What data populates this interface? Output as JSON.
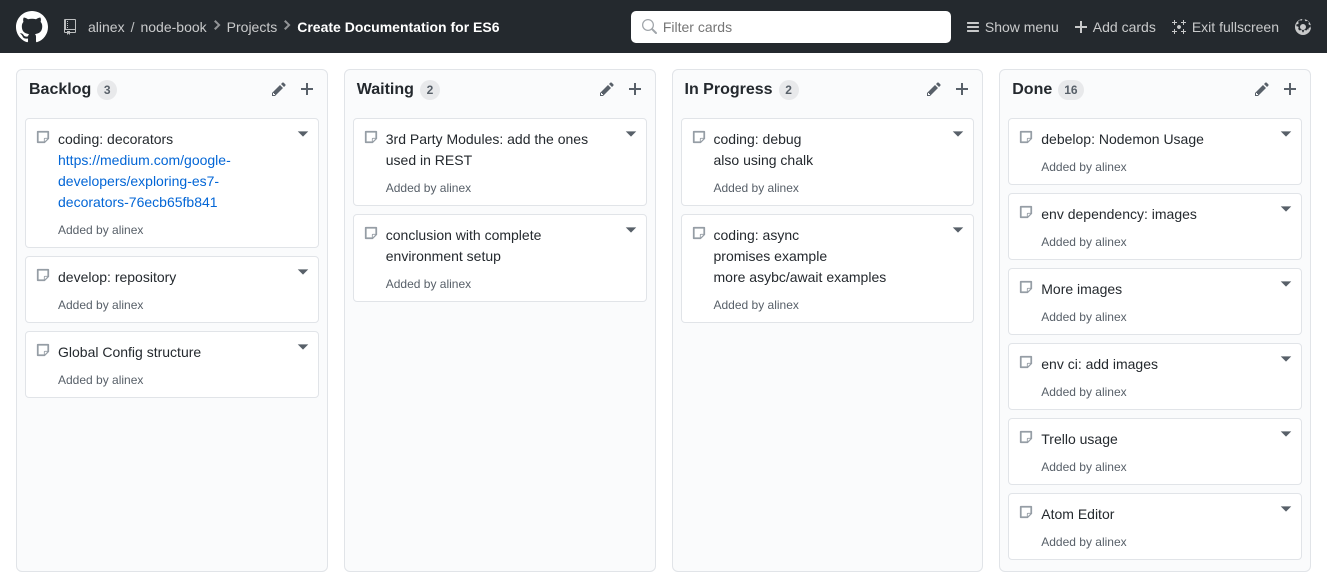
{
  "header": {
    "owner": "alinex",
    "repo": "node-book",
    "projects_label": "Projects",
    "project_name": "Create Documentation for ES6",
    "search_placeholder": "Filter cards",
    "show_menu": "Show menu",
    "add_cards": "Add cards",
    "exit_fullscreen": "Exit fullscreen"
  },
  "added_by_prefix": "Added by ",
  "columns": [
    {
      "title": "Backlog",
      "count": "3",
      "cards": [
        {
          "text": "coding: decorators",
          "link": "https://medium.com/google-developers/exploring-es7-decorators-76ecb65fb841",
          "added_by": "alinex"
        },
        {
          "text": "develop: repository",
          "added_by": "alinex"
        },
        {
          "text": "Global Config structure",
          "added_by": "alinex"
        }
      ]
    },
    {
      "title": "Waiting",
      "count": "2",
      "cards": [
        {
          "text": "3rd Party Modules: add the ones used in REST",
          "added_by": "alinex"
        },
        {
          "text": "conclusion with complete environment setup",
          "added_by": "alinex"
        }
      ]
    },
    {
      "title": "In Progress",
      "count": "2",
      "cards": [
        {
          "text": "coding: debug\nalso using chalk",
          "added_by": "alinex"
        },
        {
          "text": "coding: async\npromises example\nmore asybc/await examples",
          "added_by": "alinex"
        }
      ]
    },
    {
      "title": "Done",
      "count": "16",
      "cards": [
        {
          "text": "debelop: Nodemon Usage",
          "added_by": "alinex"
        },
        {
          "text": "env dependency: images",
          "added_by": "alinex"
        },
        {
          "text": "More images",
          "added_by": "alinex"
        },
        {
          "text": "env ci: add images",
          "added_by": "alinex"
        },
        {
          "text": "Trello usage",
          "added_by": "alinex"
        },
        {
          "text": "Atom Editor",
          "added_by": "alinex"
        }
      ]
    }
  ]
}
